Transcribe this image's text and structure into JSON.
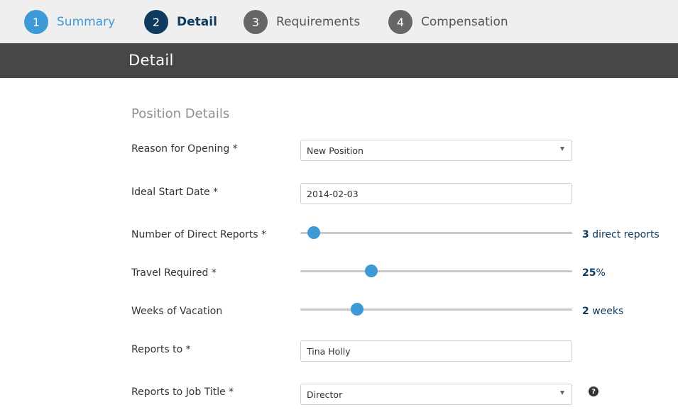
{
  "stepper": {
    "steps": [
      {
        "number": "1",
        "label": "Summary",
        "state": "done"
      },
      {
        "number": "2",
        "label": "Detail",
        "state": "active"
      },
      {
        "number": "3",
        "label": "Requirements",
        "state": "todo"
      },
      {
        "number": "4",
        "label": "Compensation",
        "state": "todo"
      }
    ]
  },
  "header": {
    "title": "Detail"
  },
  "form": {
    "section_title": "Position Details",
    "reason": {
      "label": "Reason for Opening *",
      "value": "New Position"
    },
    "start_date": {
      "label": "Ideal Start Date *",
      "value": "2014-02-03"
    },
    "direct_reports": {
      "label": "Number of Direct Reports *",
      "value": "3",
      "unit": " direct reports",
      "fraction": 0.05
    },
    "travel": {
      "label": "Travel Required *",
      "value": "25",
      "unit": "%",
      "fraction": 0.26
    },
    "vacation": {
      "label": "Weeks of Vacation",
      "value": "2",
      "unit": " weeks",
      "fraction": 0.21
    },
    "reports_to": {
      "label": "Reports to *",
      "value": "Tina Holly"
    },
    "reports_to_title": {
      "label": "Reports to Job Title *",
      "value": "Director",
      "help_icon": "question-circle-icon"
    }
  },
  "colors": {
    "accent": "#3d9ad6",
    "active": "#0f3b60",
    "inactive": "#666666",
    "titlebar": "#474747"
  }
}
